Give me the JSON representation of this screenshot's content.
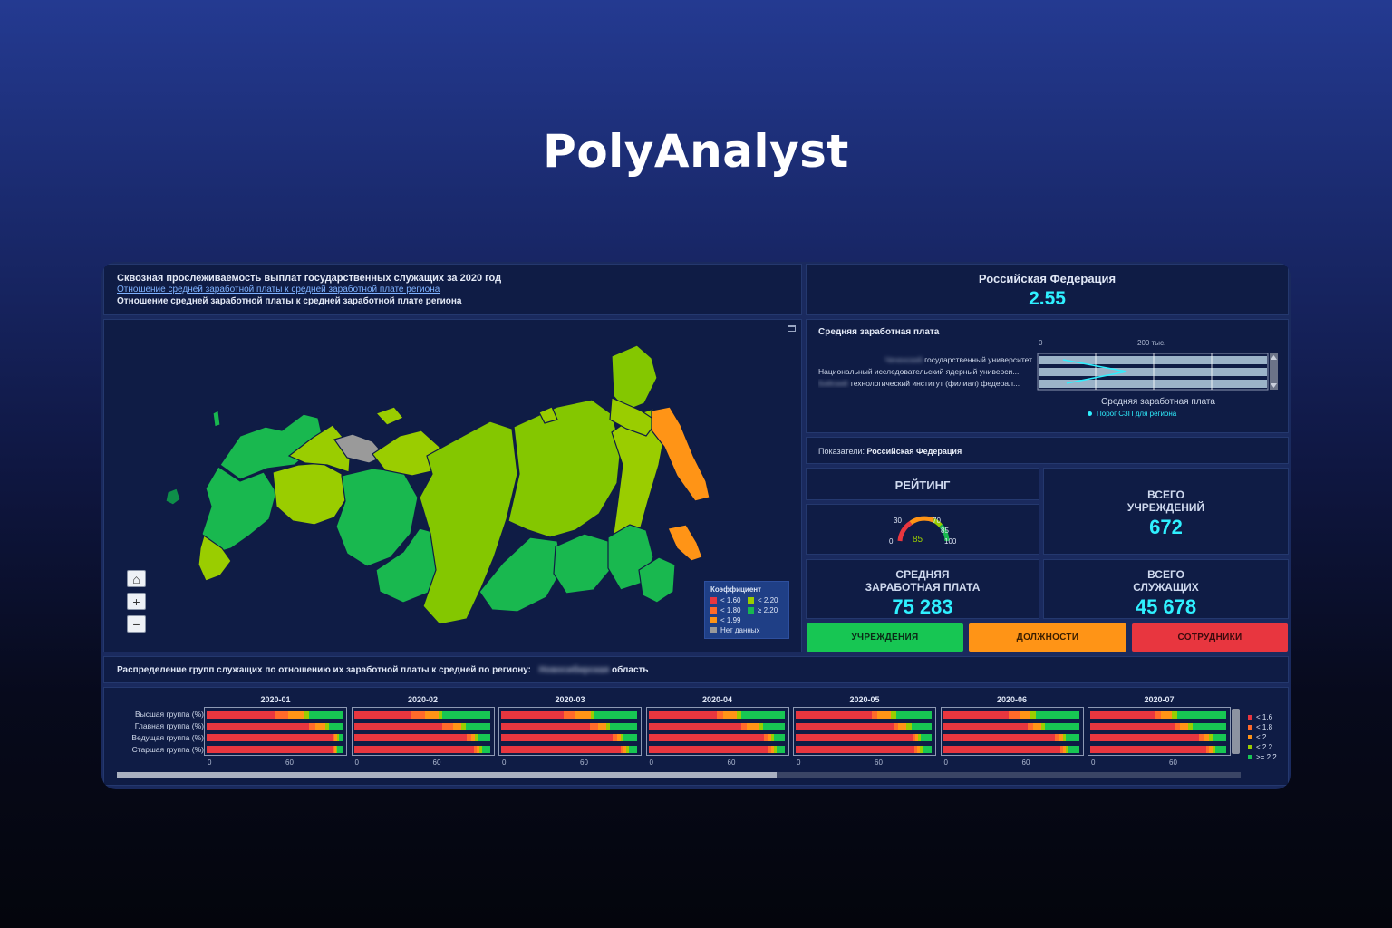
{
  "brand": "PolyAnalyst",
  "header": {
    "title": "Сквозная прослеживаемость выплат государственных служащих за 2020 год",
    "link": "Отношение средней заработной платы к средней заработной плате региона",
    "subtitle": "Отношение средней заработной платы к средней заработной плате региона"
  },
  "summary": {
    "region": "Российская Федерация",
    "value": "2.55"
  },
  "salary_chart": {
    "title": "Средняя заработная плата",
    "axis_ticks": [
      "0",
      "200 тыс."
    ],
    "rows": [
      {
        "blur": "Чеченский",
        "text": "государственный университет"
      },
      {
        "blur": "",
        "text": "Национальный исследовательский ядерный универси..."
      },
      {
        "blur": "Бийский",
        "text": "технологический институт (филиал) федерал..."
      }
    ],
    "xlabel": "Средняя заработная плата",
    "legend": "Порог СЗП для региона"
  },
  "indicators": {
    "label": "Показатели:",
    "value": "Российская Федерация"
  },
  "kpis": {
    "rating": {
      "title": "РЕЙТИНГ",
      "gauge_value": "85",
      "ticks": [
        "0",
        "30",
        "70",
        "85",
        "100"
      ]
    },
    "institutions": {
      "title1": "ВСЕГО",
      "title2": "УЧРЕЖДЕНИЙ",
      "value": "672"
    },
    "salary": {
      "title1": "СРЕДНЯЯ",
      "title2": "ЗАРАБОТНАЯ ПЛАТА",
      "value": "75 283"
    },
    "employees": {
      "title1": "ВСЕГО",
      "title2": "СЛУЖАЩИХ",
      "value": "45 678"
    }
  },
  "buttons": {
    "institutions": "УЧРЕЖДЕНИЯ",
    "positions": "ДОЛЖНОСТИ",
    "staff": "СОТРУДНИКИ"
  },
  "colors": {
    "green": "#17c653",
    "orange": "#ff9416",
    "red": "#e8363f",
    "accent": "#2ff0ff"
  },
  "map": {
    "legend_title": "Коэффициент",
    "legend": [
      {
        "label": "< 1.60",
        "color": "#e8363f"
      },
      {
        "label": "< 2.20",
        "color": "#9acd00"
      },
      {
        "label": "< 1.80",
        "color": "#ff6a2a"
      },
      {
        "label": "≥ 2.20",
        "color": "#19b84f"
      },
      {
        "label": "< 1.99",
        "color": "#ff9416"
      },
      {
        "label": "Нет данных",
        "color": "#9a9a9a"
      }
    ],
    "controls": [
      "home-icon",
      "plus-icon",
      "minus-icon"
    ]
  },
  "distribution": {
    "label": "Распределение групп служащих по отношению их заработной платы к средней по региону:",
    "region_blur": "Новосибирская",
    "region_suffix": "область"
  },
  "chart_data": {
    "type": "bar",
    "stacked": true,
    "orientation": "horizontal",
    "categories": [
      "Высшая группа (%)",
      "Главная группа (%)",
      "Ведущая группа (%)",
      "Старшая группа (%)"
    ],
    "panels": [
      "2020-01",
      "2020-02",
      "2020-03",
      "2020-04",
      "2020-05",
      "2020-06",
      "2020-07"
    ],
    "axis_ticks": [
      "0",
      "60"
    ],
    "legend": [
      "< 1.6",
      "< 1.8",
      "< 2",
      "< 2.2",
      ">= 2.2"
    ],
    "series_colors": [
      "#e8363f",
      "#ff6a2a",
      "#ff9416",
      "#9acd00",
      "#17c653"
    ],
    "values": [
      [
        [
          50,
          10,
          12,
          3,
          25
        ],
        [
          75,
          5,
          7,
          3,
          10
        ],
        [
          93,
          1,
          2,
          1,
          3
        ],
        [
          93,
          1,
          1,
          1,
          4
        ]
      ],
      [
        [
          42,
          10,
          10,
          3,
          35
        ],
        [
          65,
          8,
          6,
          3,
          18
        ],
        [
          83,
          3,
          3,
          2,
          9
        ],
        [
          88,
          2,
          2,
          2,
          6
        ]
      ],
      [
        [
          46,
          8,
          12,
          2,
          32
        ],
        [
          65,
          6,
          6,
          3,
          20
        ],
        [
          82,
          3,
          3,
          2,
          10
        ],
        [
          88,
          2,
          2,
          2,
          6
        ]
      ],
      [
        [
          50,
          5,
          10,
          3,
          32
        ],
        [
          68,
          4,
          9,
          3,
          16
        ],
        [
          85,
          3,
          2,
          2,
          8
        ],
        [
          88,
          2,
          2,
          2,
          6
        ]
      ],
      [
        [
          56,
          4,
          10,
          4,
          26
        ],
        [
          72,
          3,
          6,
          4,
          15
        ],
        [
          86,
          2,
          2,
          2,
          8
        ],
        [
          87,
          2,
          2,
          2,
          7
        ]
      ],
      [
        [
          48,
          8,
          8,
          4,
          32
        ],
        [
          62,
          4,
          6,
          3,
          25
        ],
        [
          82,
          3,
          3,
          2,
          10
        ],
        [
          86,
          2,
          2,
          2,
          8
        ]
      ],
      [
        [
          48,
          4,
          8,
          4,
          36
        ],
        [
          62,
          4,
          6,
          3,
          25
        ],
        [
          80,
          3,
          4,
          3,
          10
        ],
        [
          85,
          2,
          3,
          2,
          8
        ]
      ]
    ]
  }
}
